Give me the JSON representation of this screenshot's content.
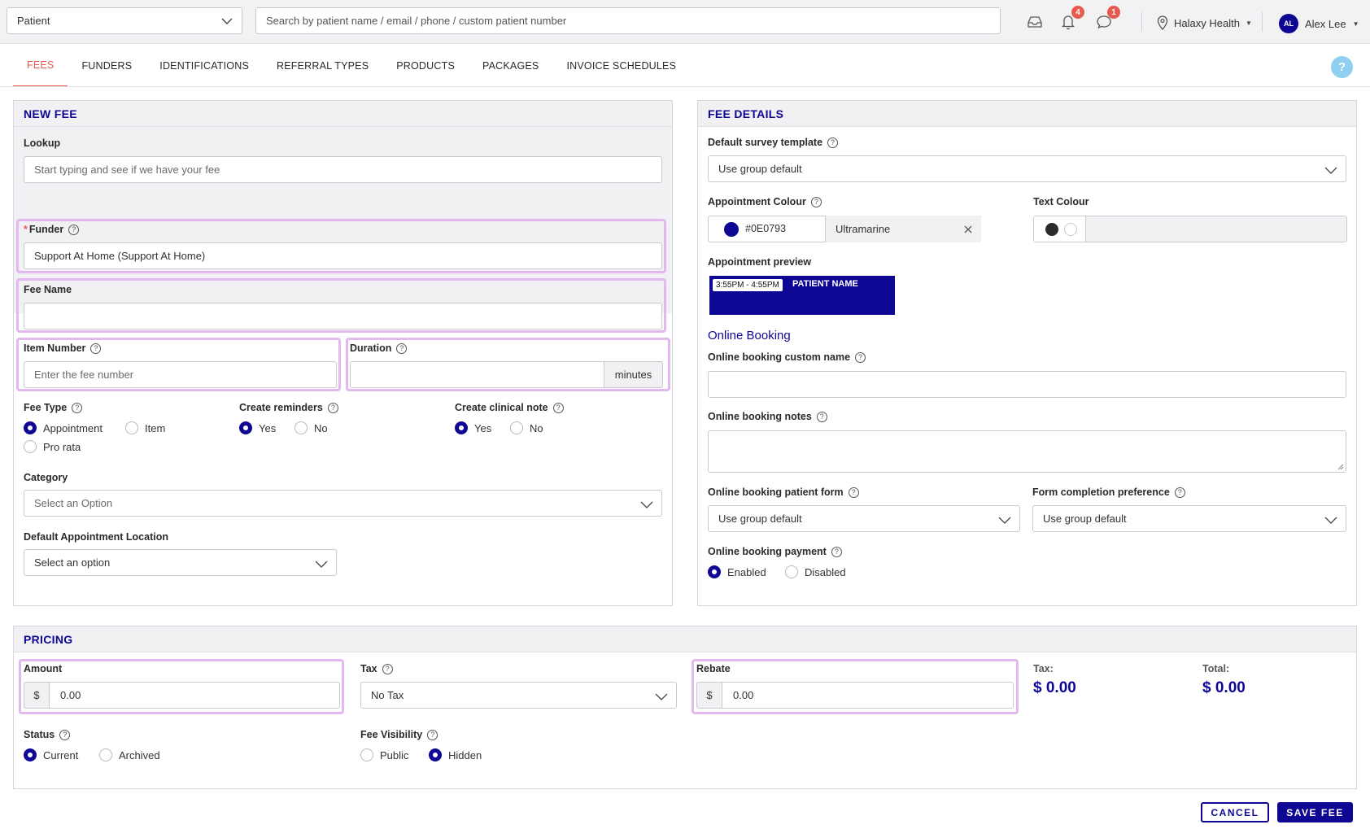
{
  "topbar": {
    "patient_select": "Patient",
    "search_placeholder": "Search by patient name / email / phone / custom patient number",
    "notifications_count": "4",
    "messages_count": "1",
    "location": "Halaxy Health",
    "user_initials": "AL",
    "user_name": "Alex Lee"
  },
  "tabs": [
    "FEES",
    "FUNDERS",
    "IDENTIFICATIONS",
    "REFERRAL TYPES",
    "PRODUCTS",
    "PACKAGES",
    "INVOICE SCHEDULES"
  ],
  "help_label": "?",
  "new_fee": {
    "title": "NEW FEE",
    "lookup_label": "Lookup",
    "lookup_placeholder": "Start typing and see if we have your fee",
    "funder_required_mark": "*",
    "funder_label": "Funder",
    "funder_value": "Support At Home (Support At Home)",
    "fee_name_label": "Fee Name",
    "fee_name_value": "",
    "item_number_label": "Item Number",
    "item_number_placeholder": "Enter the fee number",
    "duration_label": "Duration",
    "duration_value": "",
    "duration_unit": "minutes",
    "fee_type_label": "Fee Type",
    "fee_type_options": [
      "Appointment",
      "Item",
      "Pro rata"
    ],
    "fee_type_selected": "Appointment",
    "create_reminders_label": "Create reminders",
    "create_reminders_options": [
      "Yes",
      "No"
    ],
    "create_reminders_selected": "Yes",
    "create_clinical_note_label": "Create clinical note",
    "create_clinical_note_options": [
      "Yes",
      "No"
    ],
    "create_clinical_note_selected": "Yes",
    "category_label": "Category",
    "category_value": "Select an Option",
    "default_location_label": "Default Appointment Location",
    "default_location_value": "Select an option"
  },
  "fee_details": {
    "title": "FEE DETAILS",
    "survey_label": "Default survey template",
    "survey_value": "Use group default",
    "appt_colour_label": "Appointment Colour",
    "appt_colour_hex": "#0E0793",
    "appt_colour_name": "Ultramarine",
    "text_colour_label": "Text Colour",
    "text_colour_value": "",
    "preview_label": "Appointment preview",
    "preview_time": "3:55PM - 4:55PM",
    "preview_name": "PATIENT NAME",
    "online_booking_title": "Online Booking",
    "ob_custom_name_label": "Online booking custom name",
    "ob_custom_name_value": "",
    "ob_notes_label": "Online booking notes",
    "ob_notes_value": "",
    "ob_patient_form_label": "Online booking patient form",
    "ob_patient_form_value": "Use group default",
    "form_pref_label": "Form completion preference",
    "form_pref_value": "Use group default",
    "ob_payment_label": "Online booking payment",
    "ob_payment_options": [
      "Enabled",
      "Disabled"
    ],
    "ob_payment_selected": "Enabled"
  },
  "pricing": {
    "title": "PRICING",
    "amount_label": "Amount",
    "currency": "$",
    "amount_value": "0.00",
    "tax_label": "Tax",
    "tax_value": "No Tax",
    "rebate_label": "Rebate",
    "rebate_value": "0.00",
    "tax_total_label": "Tax:",
    "tax_total_value": "$ 0.00",
    "total_label": "Total:",
    "total_value": "$ 0.00",
    "status_label": "Status",
    "status_options": [
      "Current",
      "Archived"
    ],
    "status_selected": "Current",
    "visibility_label": "Fee Visibility",
    "visibility_options": [
      "Public",
      "Hidden"
    ],
    "visibility_selected": "Hidden"
  },
  "actions": {
    "cancel": "CANCEL",
    "save": "SAVE FEE"
  },
  "colors": {
    "brand": "#0e0793",
    "accent": "#e85a4f",
    "highlight": "#e3b8ef"
  }
}
